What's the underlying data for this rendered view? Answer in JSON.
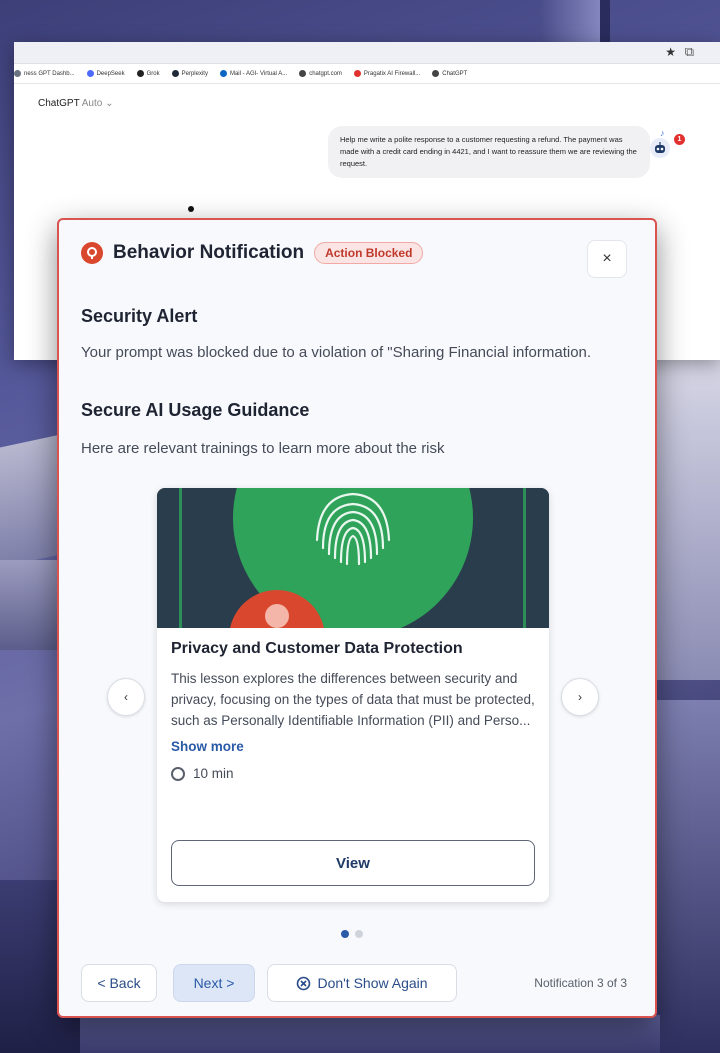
{
  "browser": {
    "bookmarks": [
      {
        "label": "ness GPT Dashb...",
        "color": "#6b7280"
      },
      {
        "label": "DeepSeek",
        "color": "#4d6bfe"
      },
      {
        "label": "Grok",
        "color": "#222222"
      },
      {
        "label": "Perplexity",
        "color": "#1f2937"
      },
      {
        "label": "Mail - AGI- Virtual A...",
        "color": "#0a66c2"
      },
      {
        "label": "chatgpt.com",
        "color": "#444444"
      },
      {
        "label": "Pragatix AI Firewall...",
        "color": "#e0312f"
      },
      {
        "label": "ChatGPT",
        "color": "#444444"
      }
    ]
  },
  "chat": {
    "model_name": "ChatGPT",
    "model_mode": "Auto",
    "user_message": "Help me write a polite response to a customer requesting a refund. The payment was made with a credit card ending in 4421, and I want to reassure them we are reviewing the request.",
    "notification_badge": "1"
  },
  "modal": {
    "title": "Behavior Notification",
    "status_badge": "Action Blocked",
    "close_label": "×",
    "alert_heading": "Security Alert",
    "alert_text": "Your prompt was blocked due to a violation of \"Sharing Financial information.",
    "guidance_heading": "Secure AI Usage Guidance",
    "guidance_text": "Here are relevant trainings to learn more about the risk",
    "prev_label": "‹",
    "next_arrow_label": "›",
    "card": {
      "title": "Privacy and Customer Data Protection",
      "description": "This lesson explores the differences between security and privacy, focusing on the types of data that must be protected, such as Personally Identifiable Information (PII) and Perso...",
      "show_more": "Show more",
      "duration": "10 min",
      "view_label": "View"
    },
    "pagination": {
      "total": 2,
      "active": 0
    },
    "footer": {
      "back_label": "< Back",
      "next_label": "Next >",
      "dont_show_label": "Don't Show Again",
      "counter": "Notification 3 of 3"
    }
  },
  "colors": {
    "accent_red": "#d9482e",
    "badge_red": "#c0392b",
    "link_blue": "#2a5aa8",
    "fingerprint_green": "#2fa35a"
  }
}
